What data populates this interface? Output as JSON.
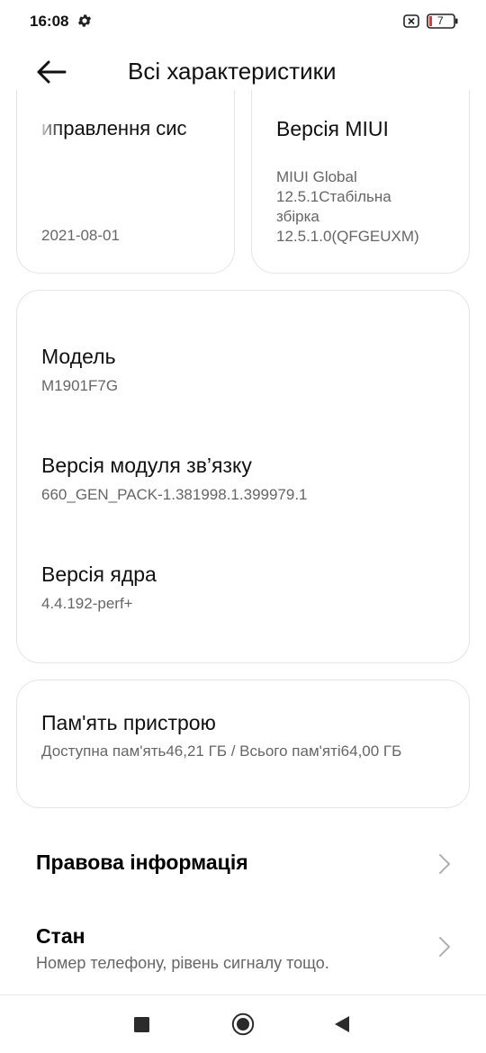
{
  "status_bar": {
    "time": "16:08",
    "battery_level": "7",
    "icons": [
      "gear-icon",
      "sim-error-icon",
      "battery-icon"
    ]
  },
  "header": {
    "title": "Всі характеристики",
    "back_icon": "arrow-left-icon"
  },
  "top_cards": [
    {
      "title": "иправлення сис",
      "value": "2021-08-01"
    },
    {
      "title": "Версія MIUI",
      "value_lines": [
        "MIUI Global",
        "12.5.1Стабільна",
        "збірка",
        "12.5.1.0(QFGEUXM)"
      ]
    }
  ],
  "info_card": {
    "items": [
      {
        "label": "Модель",
        "value": "M1901F7G"
      },
      {
        "label": "Версія модуля зв’язку",
        "value": "660_GEN_PACK-1.381998.1.399979.1"
      },
      {
        "label": "Версія ядра",
        "value": "4.4.192-perf+"
      }
    ]
  },
  "memory_card": {
    "label": "Пам'ять пристрою",
    "value": "Доступна пам'ять46,21 ГБ / Всього пам'яті64,00 ГБ"
  },
  "list_rows": [
    {
      "title": "Правова інформація",
      "subtitle": ""
    },
    {
      "title": "Стан",
      "subtitle": "Номер телефону, рівень сигналу тощо."
    }
  ],
  "nav_bar": {
    "buttons": [
      "recents-square-icon",
      "home-circle-icon",
      "back-triangle-icon"
    ]
  },
  "colors": {
    "background": "#ffffff",
    "primary_text": "#111111",
    "secondary_text": "#666666",
    "card_border": "#e4e4e4",
    "battery_low": "#e53935"
  }
}
